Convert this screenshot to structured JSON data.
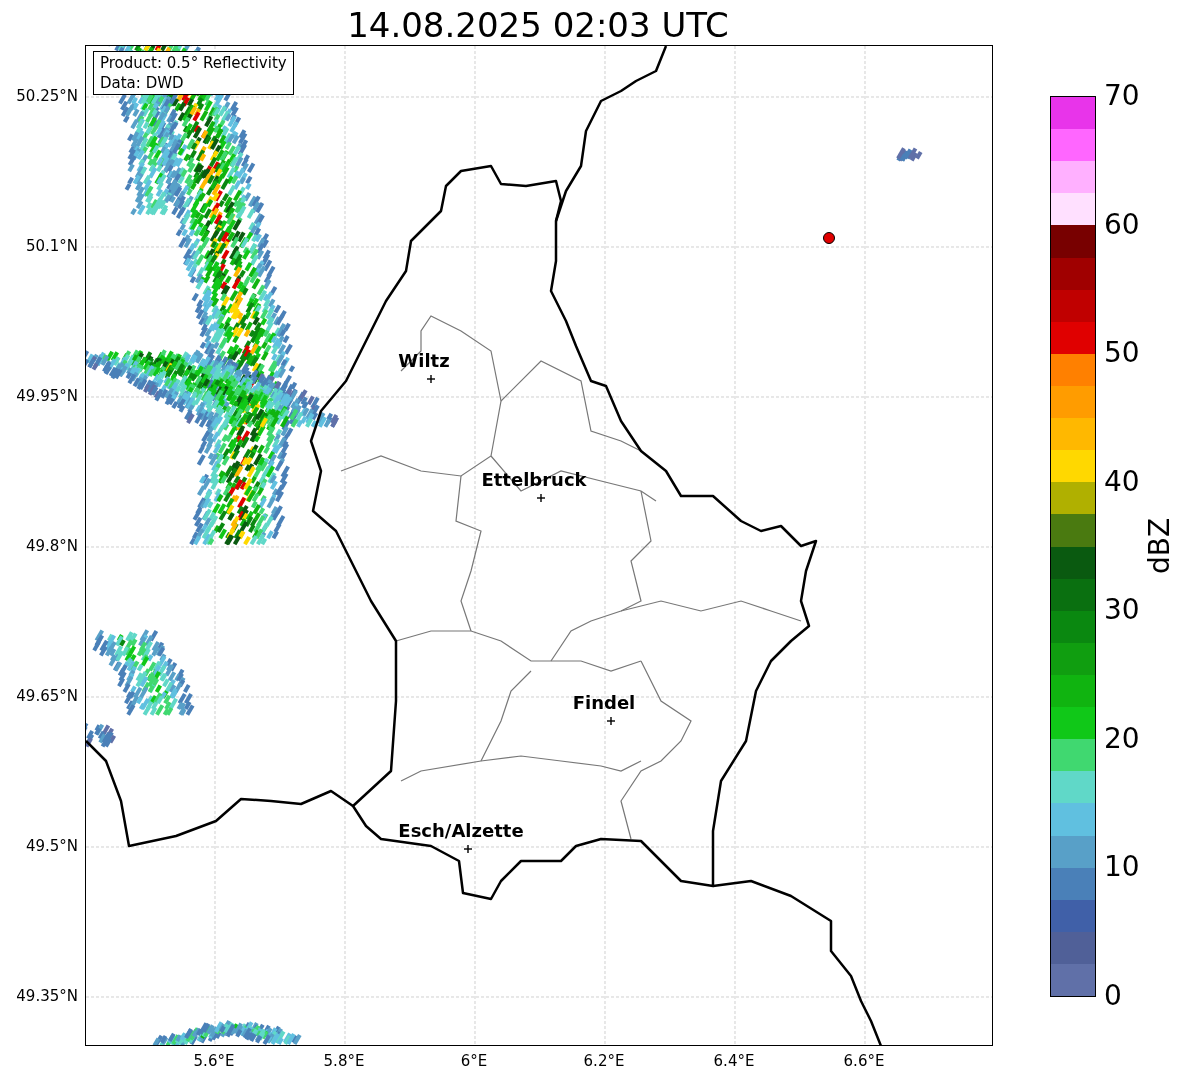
{
  "title": "14.08.2025 02:03 UTC",
  "info_box": [
    "Product: 0.5° Reflectivity",
    "Data: DWD"
  ],
  "map": {
    "lat_ticks": [
      "50.25°N",
      "50.1°N",
      "49.95°N",
      "49.8°N",
      "49.65°N",
      "49.5°N",
      "49.35°N"
    ],
    "lon_ticks": [
      "5.6°E",
      "5.8°E",
      "6°E",
      "6.2°E",
      "6.4°E",
      "6.6°E"
    ],
    "cities": [
      {
        "name": "Wiltz"
      },
      {
        "name": "Ettelbruck"
      },
      {
        "name": "Findel"
      },
      {
        "name": "Esch/Alzette"
      }
    ]
  },
  "colorbar": {
    "label": "dBZ",
    "ticks": [
      "70",
      "60",
      "50",
      "40",
      "30",
      "20",
      "10",
      "0"
    ],
    "bands": [
      {
        "color": "#e834ea"
      },
      {
        "color": "#ff66ff"
      },
      {
        "color": "#ffb0ff"
      },
      {
        "color": "#ffe0ff"
      },
      {
        "color": "#780000"
      },
      {
        "color": "#a00000"
      },
      {
        "color": "#c00000"
      },
      {
        "color": "#e00000"
      },
      {
        "color": "#ff8000"
      },
      {
        "color": "#ff9c00"
      },
      {
        "color": "#ffb800"
      },
      {
        "color": "#ffd800"
      },
      {
        "color": "#b0b000"
      },
      {
        "color": "#4a7a10"
      },
      {
        "color": "#0a5a10"
      },
      {
        "color": "#0a7010"
      },
      {
        "color": "#0a8810"
      },
      {
        "color": "#109e10"
      },
      {
        "color": "#10b410"
      },
      {
        "color": "#10c818"
      },
      {
        "color": "#40d870"
      },
      {
        "color": "#60d8c8"
      },
      {
        "color": "#60c0e0"
      },
      {
        "color": "#58a0c8"
      },
      {
        "color": "#4a80b8"
      },
      {
        "color": "#4060a8"
      },
      {
        "color": "#506098"
      },
      {
        "color": "#6070a8"
      }
    ]
  }
}
